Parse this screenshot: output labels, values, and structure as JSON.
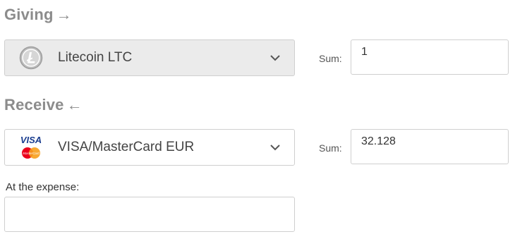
{
  "giving": {
    "title": "Giving",
    "arrow": "→",
    "currency_icon": "litecoin-icon",
    "currency_label": "Litecoin LTC",
    "sum_label": "Sum:",
    "sum_value": "1"
  },
  "receive": {
    "title": "Receive",
    "arrow": "←",
    "currency_icon": "visa-mastercard-icon",
    "currency_label": "VISA/MasterCard EUR",
    "sum_label": "Sum:",
    "sum_value": "32.128",
    "card_logo_text": "VISA",
    "mc_logo_text": "MasterCard"
  },
  "expense": {
    "label": "At the expense:",
    "value": ""
  },
  "colors": {
    "title_gray": "#8c8c8c",
    "border": "#cfcfcf",
    "disabled_bg": "#ebebeb",
    "visa_blue": "#1a3d8f",
    "mc_red": "#eb001b",
    "mc_orange": "#f79e1b"
  }
}
